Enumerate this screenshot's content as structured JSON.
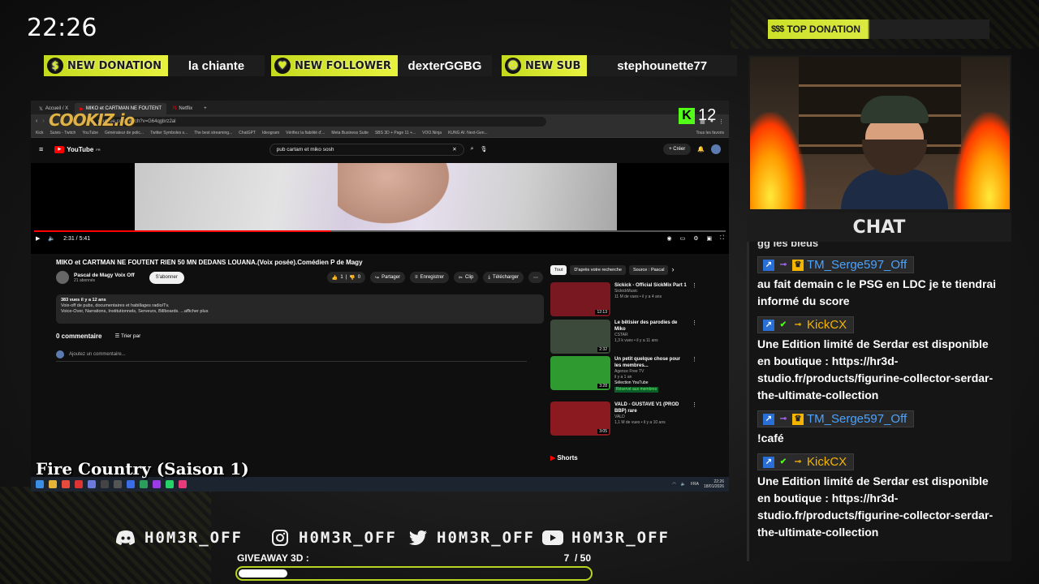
{
  "clock": "22:26",
  "top_donation": {
    "label": "TOP DONATION",
    "icon": "$$$"
  },
  "alerts": [
    {
      "label": "NEW DONATION",
      "value": "la chiante",
      "icon": "$"
    },
    {
      "label": "NEW FOLLOWER",
      "value": "dexterGGBG",
      "icon": "heart"
    },
    {
      "label": "NEW SUB",
      "value": "stephounette77",
      "icon": "users"
    }
  ],
  "overlay": {
    "cookiz": "COOKIZ.io",
    "kick_viewers": "12",
    "now_playing": "Fire Country (Saison 1)"
  },
  "browser": {
    "tabs": [
      "Accueil / X",
      "MIKO et CARTMAN NE FOUTENT",
      "Netflix"
    ],
    "url": "youtube.com/watch?v=G64qgbrz2al",
    "bookmarks": [
      "Kick",
      "Suivis - Twitch",
      "YouTube",
      "Générateur de polic...",
      "Twitter Symboles s...",
      "The best streaming...",
      "ChatGPT",
      "Ideogram",
      "Vérifiez la fiabilité d'...",
      "Meta Business Suite",
      "SBS 3D + Page 11 +...",
      "VOO.Ninja",
      "KUNG AI: Next-Gen...",
      "Tous les favoris"
    ]
  },
  "youtube": {
    "logo": "YouTube",
    "country": "FR",
    "search_query": "pub cartam et miko sosh",
    "create": "+ Créer",
    "time": "2:31 / 5:41",
    "progress": 0.43,
    "video_title": "MIKO et CARTMAN NE FOUTENT RIEN 50 MN DEDANS LOUANA.(Voix posée).Comédien P de Magy",
    "channel": "Pascal de Magy Voix Off",
    "subscribers": "21 abonnés",
    "subscribe": "S'abonner",
    "likes": "1",
    "dislikes": "0",
    "actions": [
      "Partager",
      "Enregistrer",
      "Clip",
      "Télécharger"
    ],
    "desc_meta": "383 vues  il y a 12 ans",
    "desc_line1": "Voix-off de pubs, documentaires et habillages radio/Tv.",
    "desc_line2": "Voice-Over, Narrations, Institutionnels, Serveurs, Billboards. ...afficher plus",
    "comments": "0 commentaire",
    "sort": "Trier par",
    "add_comment": "Ajoutez un commentaire...",
    "chips": [
      "Tout",
      "D'après votre recherche",
      "Source : Pascal"
    ],
    "recs": [
      {
        "title": "Sickick - Official SickMix Part 1",
        "meta1": "SickickMusic",
        "meta2": "11 M de vues • il y a 4 ans",
        "meta3": "",
        "dur": "12:13",
        "color": "#7a1822"
      },
      {
        "title": "Le bêtisier des parodies de Miko",
        "meta1": "CSTAR",
        "meta2": "1,3 k vues • il y a 11 ans",
        "meta3": "",
        "dur": "2:32",
        "color": "#3b4a3a"
      },
      {
        "title": "Un petit quelque chose pour les membres...",
        "meta1": "Agence Free TV",
        "meta2": "il y a 1 an",
        "meta3": "Sélection YouTube",
        "badge": "Réservé aux membres",
        "dur": "3:28",
        "color": "#2f9a30"
      },
      {
        "title": "VALD - GUSTAVE V1 (PROD BBP) rare",
        "meta1": "VALD",
        "meta2": "1,1 M de vues • il y a 10 ans",
        "meta3": "",
        "dur": "3:05",
        "color": "#8a1a1f"
      }
    ],
    "shorts": "Shorts"
  },
  "taskbar": {
    "lang": "FRA",
    "time": "22:26",
    "date": "18/01/2026"
  },
  "chat": {
    "header": "CHAT",
    "cut_text": "gg les bleus",
    "messages": [
      {
        "user": "TM_Serge597_Off",
        "text": "au fait demain c le PSG en LDC je te tiendrai informé du score",
        "color": "#4aa3ff"
      },
      {
        "user": "KickCX",
        "text": "Une Edition limité de Serdar est disponible en boutique : https://hr3d-studio.fr/products/figurine-collector-serdar-the-ultimate-collection",
        "color": "#f5b400"
      },
      {
        "user": "TM_Serge597_Off",
        "text": "!café",
        "color": "#4aa3ff"
      },
      {
        "user": "KickCX",
        "text": "Une Edition limité de Serdar est disponible en boutique : https://hr3d-studio.fr/products/figurine-collector-serdar-the-ultimate-collection",
        "color": "#f5b400"
      }
    ]
  },
  "socials": [
    {
      "icon": "discord-icon",
      "handle": "H0M3R_OFF"
    },
    {
      "icon": "instagram-icon",
      "handle": "H0M3R_OFF"
    },
    {
      "icon": "twitter-icon",
      "handle": "H0M3R_OFF"
    },
    {
      "icon": "youtube-icon",
      "handle": "H0M3R_OFF"
    }
  ],
  "giveaway": {
    "label": "GIVEAWAY 3D :",
    "current": "7",
    "total": "/ 50",
    "progress": 0.14
  },
  "colors": {
    "accent": "#c8dc22",
    "kick": "#53fc18",
    "yt_red": "#ff0000"
  }
}
